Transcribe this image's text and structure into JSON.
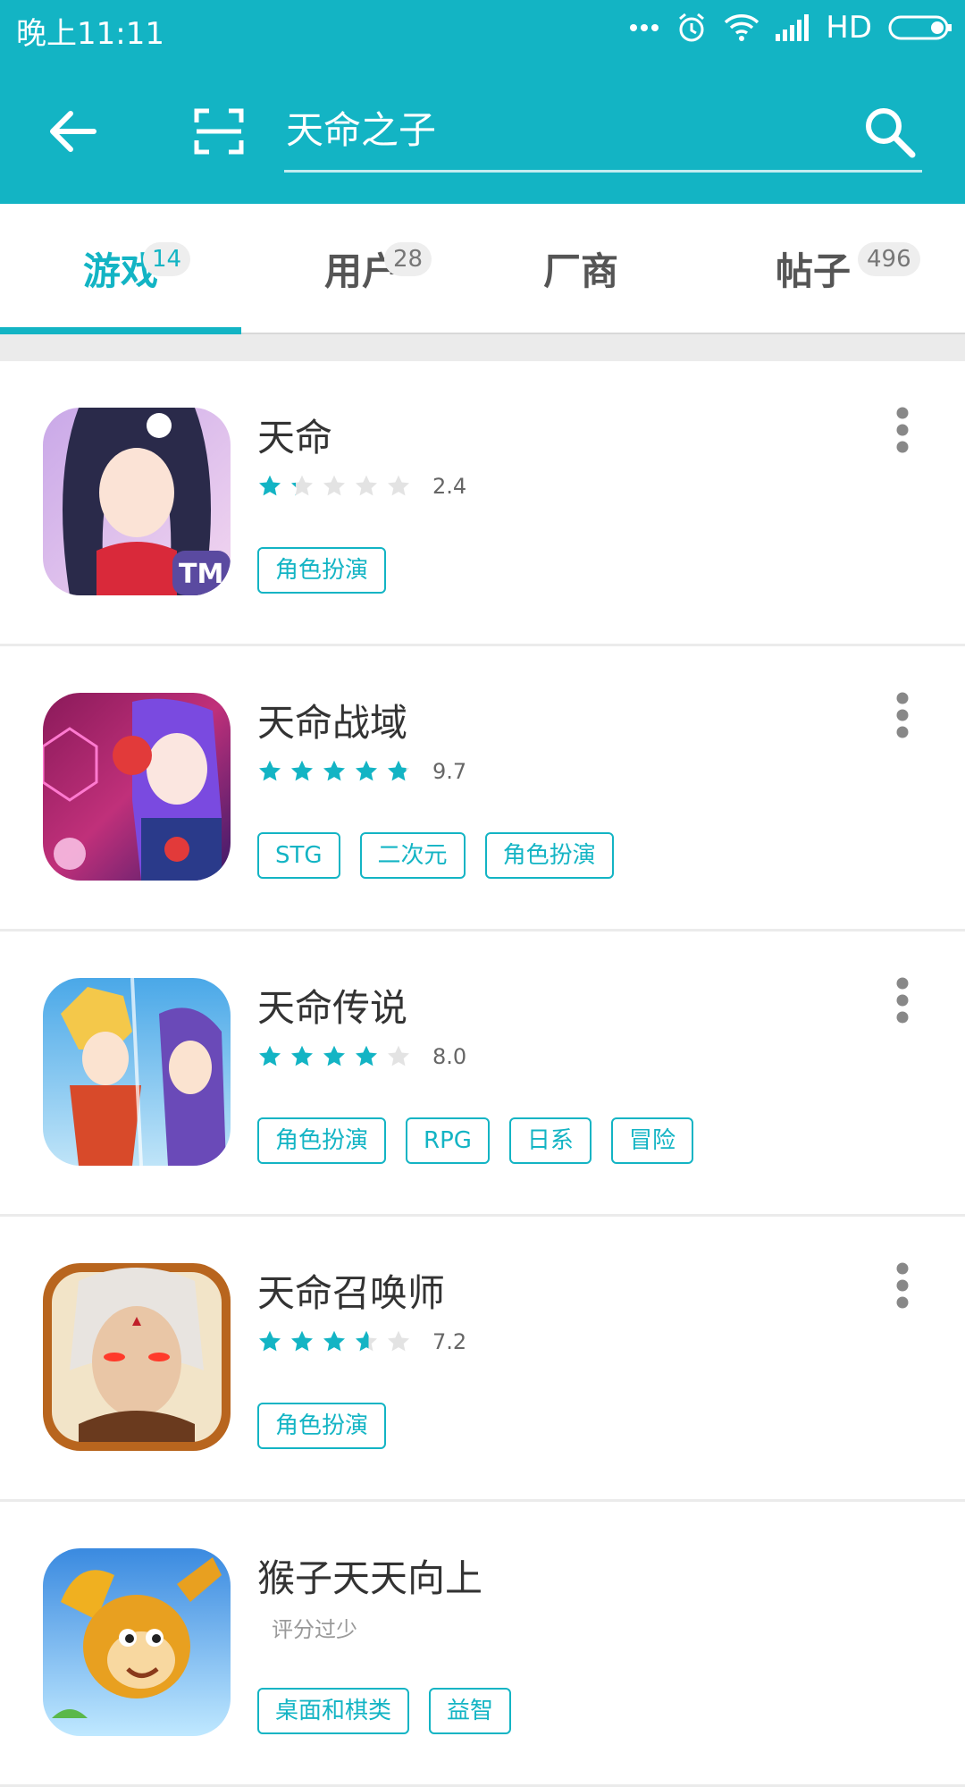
{
  "status_bar": {
    "time": "晚上11:11",
    "network": "HD"
  },
  "search": {
    "query": "天命之子"
  },
  "tabs": [
    {
      "label": "游戏",
      "count": "14"
    },
    {
      "label": "用户",
      "count": "28"
    },
    {
      "label": "厂商",
      "count": ""
    },
    {
      "label": "帖子",
      "count": "496"
    }
  ],
  "apps": [
    {
      "name": "天命",
      "rating_text": "2.4",
      "rating": 2.4,
      "tags": [
        "角色扮演"
      ]
    },
    {
      "name": "天命战域",
      "rating_text": "9.7",
      "rating": 9.7,
      "tags": [
        "STG",
        "二次元",
        "角色扮演"
      ]
    },
    {
      "name": "天命传说",
      "rating_text": "8.0",
      "rating": 8.0,
      "tags": [
        "角色扮演",
        "RPG",
        "日系",
        "冒险"
      ]
    },
    {
      "name": "天命召唤师",
      "rating_text": "7.2",
      "rating": 7.2,
      "tags": [
        "角色扮演"
      ]
    },
    {
      "name": "猴子天天向上",
      "rating_text": "评分过少",
      "rating": null,
      "tags": [
        "桌面和棋类",
        "益智"
      ]
    }
  ],
  "colors": {
    "accent": "#13b4c4",
    "star_empty": "#e3e3e3"
  }
}
